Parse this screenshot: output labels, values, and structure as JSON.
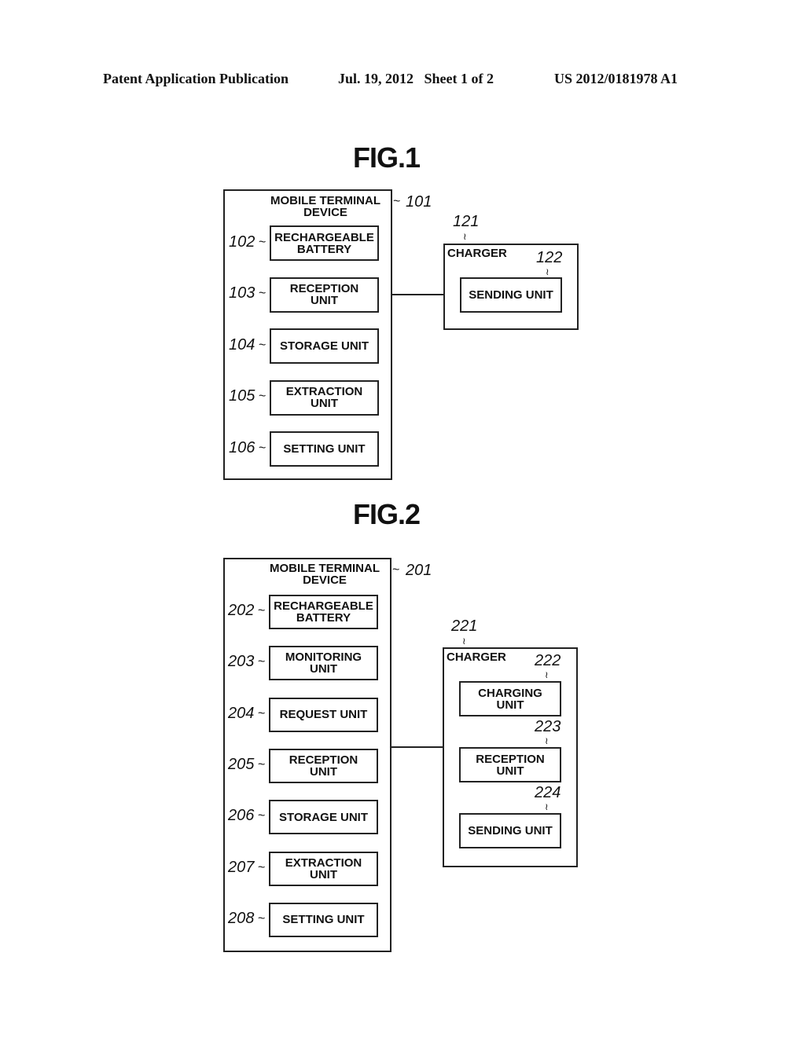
{
  "header": {
    "left": "Patent Application Publication",
    "center": "Jul. 19, 2012   Sheet 1 of 2",
    "right": "US 2012/0181978 A1"
  },
  "fig1": {
    "title": "FIG.1",
    "device": {
      "ref": "101",
      "title_line1": "MOBILE TERMINAL",
      "title_line2": "DEVICE",
      "units": [
        {
          "ref": "102",
          "line1": "RECHARGEABLE",
          "line2": "BATTERY"
        },
        {
          "ref": "103",
          "line1": "RECEPTION",
          "line2": "UNIT"
        },
        {
          "ref": "104",
          "line1": "STORAGE UNIT",
          "line2": ""
        },
        {
          "ref": "105",
          "line1": "EXTRACTION",
          "line2": "UNIT"
        },
        {
          "ref": "106",
          "line1": "SETTING UNIT",
          "line2": ""
        }
      ]
    },
    "charger": {
      "ref": "121",
      "title": "CHARGER",
      "units": [
        {
          "ref": "122",
          "line1": "SENDING UNIT",
          "line2": ""
        }
      ]
    }
  },
  "fig2": {
    "title": "FIG.2",
    "device": {
      "ref": "201",
      "title_line1": "MOBILE TERMINAL",
      "title_line2": "DEVICE",
      "units": [
        {
          "ref": "202",
          "line1": "RECHARGEABLE",
          "line2": "BATTERY"
        },
        {
          "ref": "203",
          "line1": "MONITORING",
          "line2": "UNIT"
        },
        {
          "ref": "204",
          "line1": "REQUEST UNIT",
          "line2": ""
        },
        {
          "ref": "205",
          "line1": "RECEPTION",
          "line2": "UNIT"
        },
        {
          "ref": "206",
          "line1": "STORAGE UNIT",
          "line2": ""
        },
        {
          "ref": "207",
          "line1": "EXTRACTION",
          "line2": "UNIT"
        },
        {
          "ref": "208",
          "line1": "SETTING UNIT",
          "line2": ""
        }
      ]
    },
    "charger": {
      "ref": "221",
      "title": "CHARGER",
      "units": [
        {
          "ref": "222",
          "line1": "CHARGING",
          "line2": "UNIT"
        },
        {
          "ref": "223",
          "line1": "RECEPTION",
          "line2": "UNIT"
        },
        {
          "ref": "224",
          "line1": "SENDING UNIT",
          "line2": ""
        }
      ]
    }
  },
  "symbols": {
    "tilde": "~",
    "squiggle": "≀"
  }
}
